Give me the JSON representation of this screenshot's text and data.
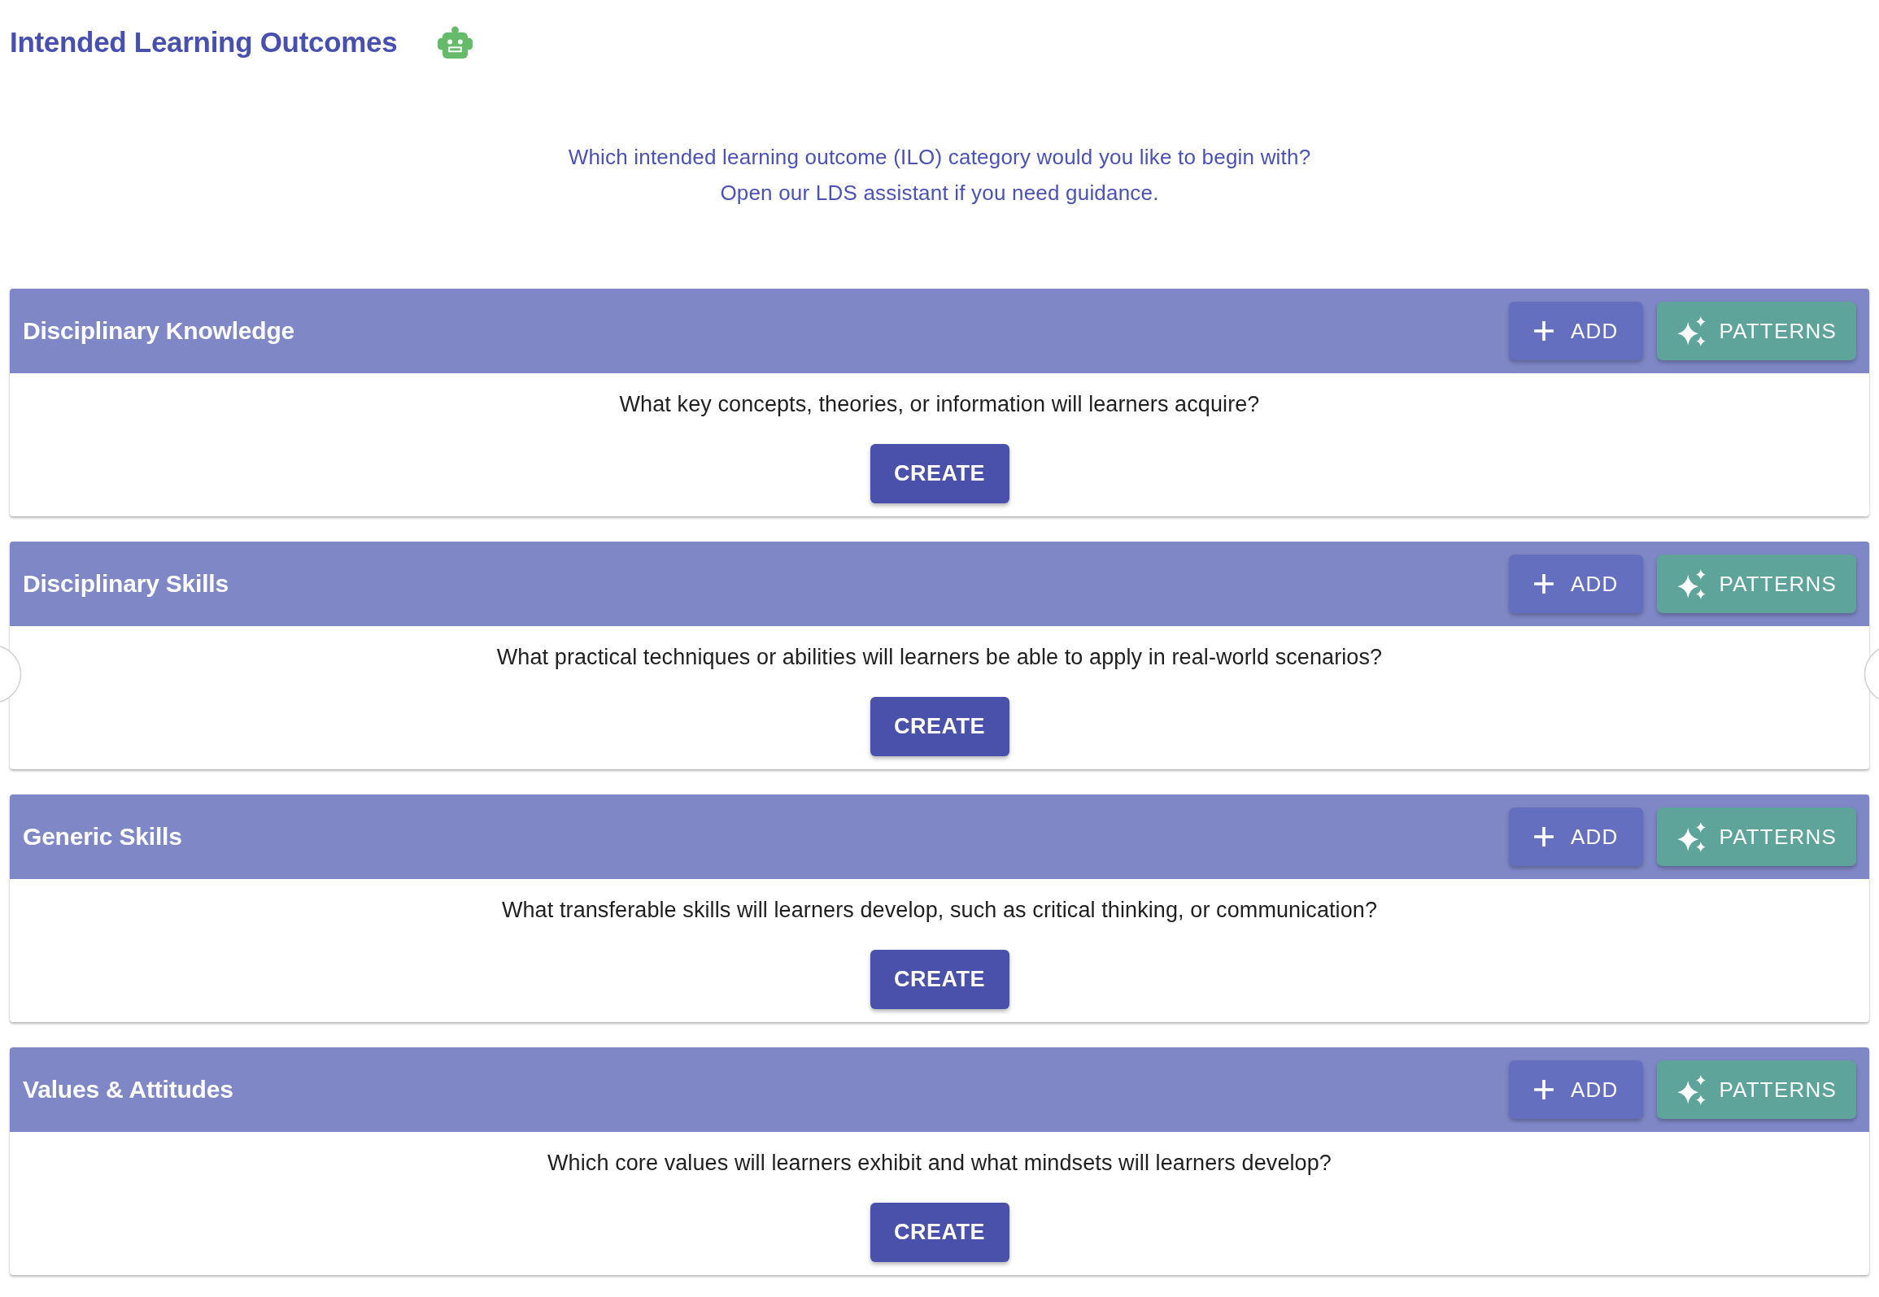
{
  "header": {
    "title": "Intended Learning Outcomes"
  },
  "intro": {
    "lines": [
      "Which intended learning outcome (ILO) category would you like to begin with?",
      "Open our LDS assistant if you need guidance."
    ]
  },
  "categories": [
    {
      "title": "Disciplinary Knowledge",
      "actions": [
        {
          "kind": "add",
          "label": "ADD"
        },
        {
          "kind": "patterns",
          "label": "PATTERNS"
        }
      ],
      "question": "What key concepts, theories, or information will learners acquire?",
      "create_label": "CREATE"
    },
    {
      "title": "Disciplinary Skills",
      "actions": [
        {
          "kind": "add",
          "label": "ADD"
        },
        {
          "kind": "patterns",
          "label": "PATTERNS"
        }
      ],
      "question": "What practical techniques or abilities will learners be able to apply in real-world scenarios?",
      "create_label": "CREATE"
    },
    {
      "title": "Generic Skills",
      "actions": [
        {
          "kind": "add",
          "label": "ADD"
        },
        {
          "kind": "patterns",
          "label": "PATTERNS"
        }
      ],
      "question": "What transferable skills will learners develop, such as critical thinking, or communication?",
      "create_label": "CREATE"
    },
    {
      "title": "Values & Attitudes",
      "actions": [
        {
          "kind": "add",
          "label": "ADD"
        },
        {
          "kind": "patterns",
          "label": "PATTERNS"
        }
      ],
      "question": "Which core values will learners exhibit and what mindsets will learners develop?",
      "create_label": "CREATE"
    }
  ]
}
